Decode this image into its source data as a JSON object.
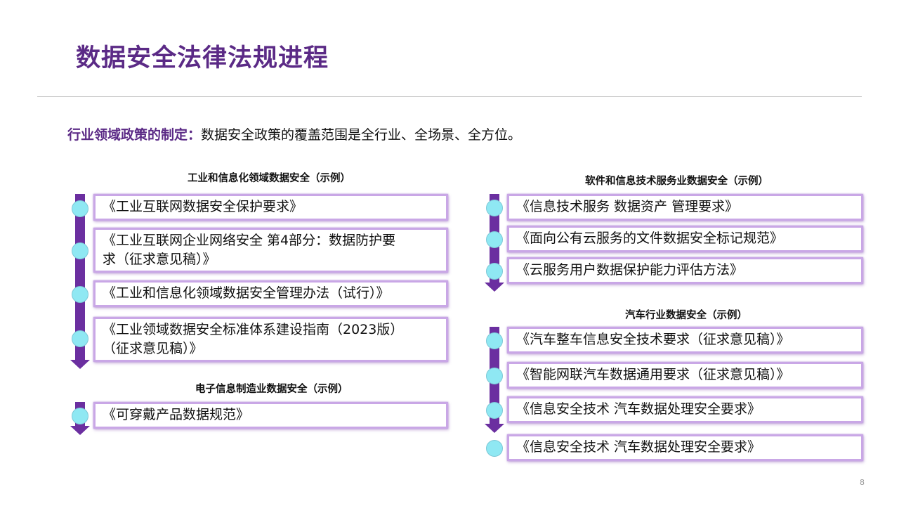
{
  "title": "数据安全法律法规进程",
  "intro": {
    "lead": "行业领域政策的制定：",
    "text": "数据安全政策的覆盖范围是全行业、全场景、全方位。"
  },
  "groups": {
    "industry": {
      "title": "工业和信息化领域数据安全（示例）",
      "items": [
        "《工业互联网数据安全保护要求》",
        "《工业互联网企业网络安全 第4部分：数据防护要",
        "求（征求意见稿）》",
        "《工业和信息化领域数据安全管理办法（试行）》",
        "《工业领域数据安全标准体系建设指南（2023版）",
        "（征求意见稿）》"
      ]
    },
    "electronics": {
      "title": "电子信息制造业数据安全（示例）",
      "items": [
        "《可穿戴产品数据规范》"
      ]
    },
    "software": {
      "title": "软件和信息技术服务业数据安全（示例）",
      "items": [
        "《信息技术服务 数据资产 管理要求》",
        "《面向公有云服务的文件数据安全标记规范》",
        "《云服务用户数据保护能力评估方法》"
      ]
    },
    "auto": {
      "title": "汽车行业数据安全（示例）",
      "items": [
        "《汽车整车信息安全技术要求（征求意见稿）》",
        "《智能网联汽车数据通用要求（征求意见稿）》",
        "《信息安全技术 汽车数据处理安全要求》",
        "《信息安全技术 汽车数据处理安全要求》"
      ]
    }
  },
  "page_number": "8",
  "colors": {
    "accent": "#5b2a86",
    "bar": "#6b2fa0",
    "dot": "#8fe8f3",
    "box_border": "#c9a7e6"
  }
}
